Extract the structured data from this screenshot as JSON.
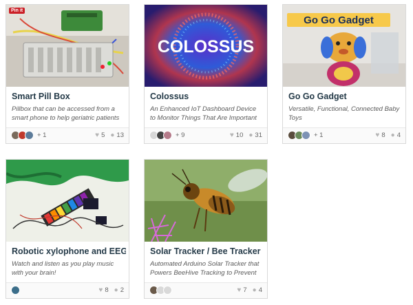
{
  "projects": [
    {
      "title": "Smart Pill Box",
      "description": "Pillbox that can be accessed from a smart phone to help geriatric patients",
      "more": "+ 1",
      "likes": "5",
      "comments": "13",
      "pin_label": "Pin it"
    },
    {
      "title": "Colossus",
      "description": "An Enhanced IoT Dashboard Device to Monitor Things That Are Important",
      "image_text": "COLOSSUS",
      "more": "+ 9",
      "likes": "10",
      "comments": "31"
    },
    {
      "title": "Go Go Gadget",
      "description": "Versatile, Functional, Connected Baby Toys",
      "image_text": "Go Go Gadget",
      "more": "+ 1",
      "likes": "8",
      "comments": "4"
    },
    {
      "title": "Robotic xylophone and EEG",
      "description": "Watch and listen as you play music with your brain!",
      "likes": "8",
      "comments": "2"
    },
    {
      "title": "Solar Tracker / Bee Tracker",
      "description": "Automated Arduino Solar Tracker that Powers BeeHive Tracking to Prevent",
      "likes": "7",
      "comments": "4"
    }
  ],
  "icons": {
    "like": "heart-icon",
    "comment": "comment-icon"
  }
}
